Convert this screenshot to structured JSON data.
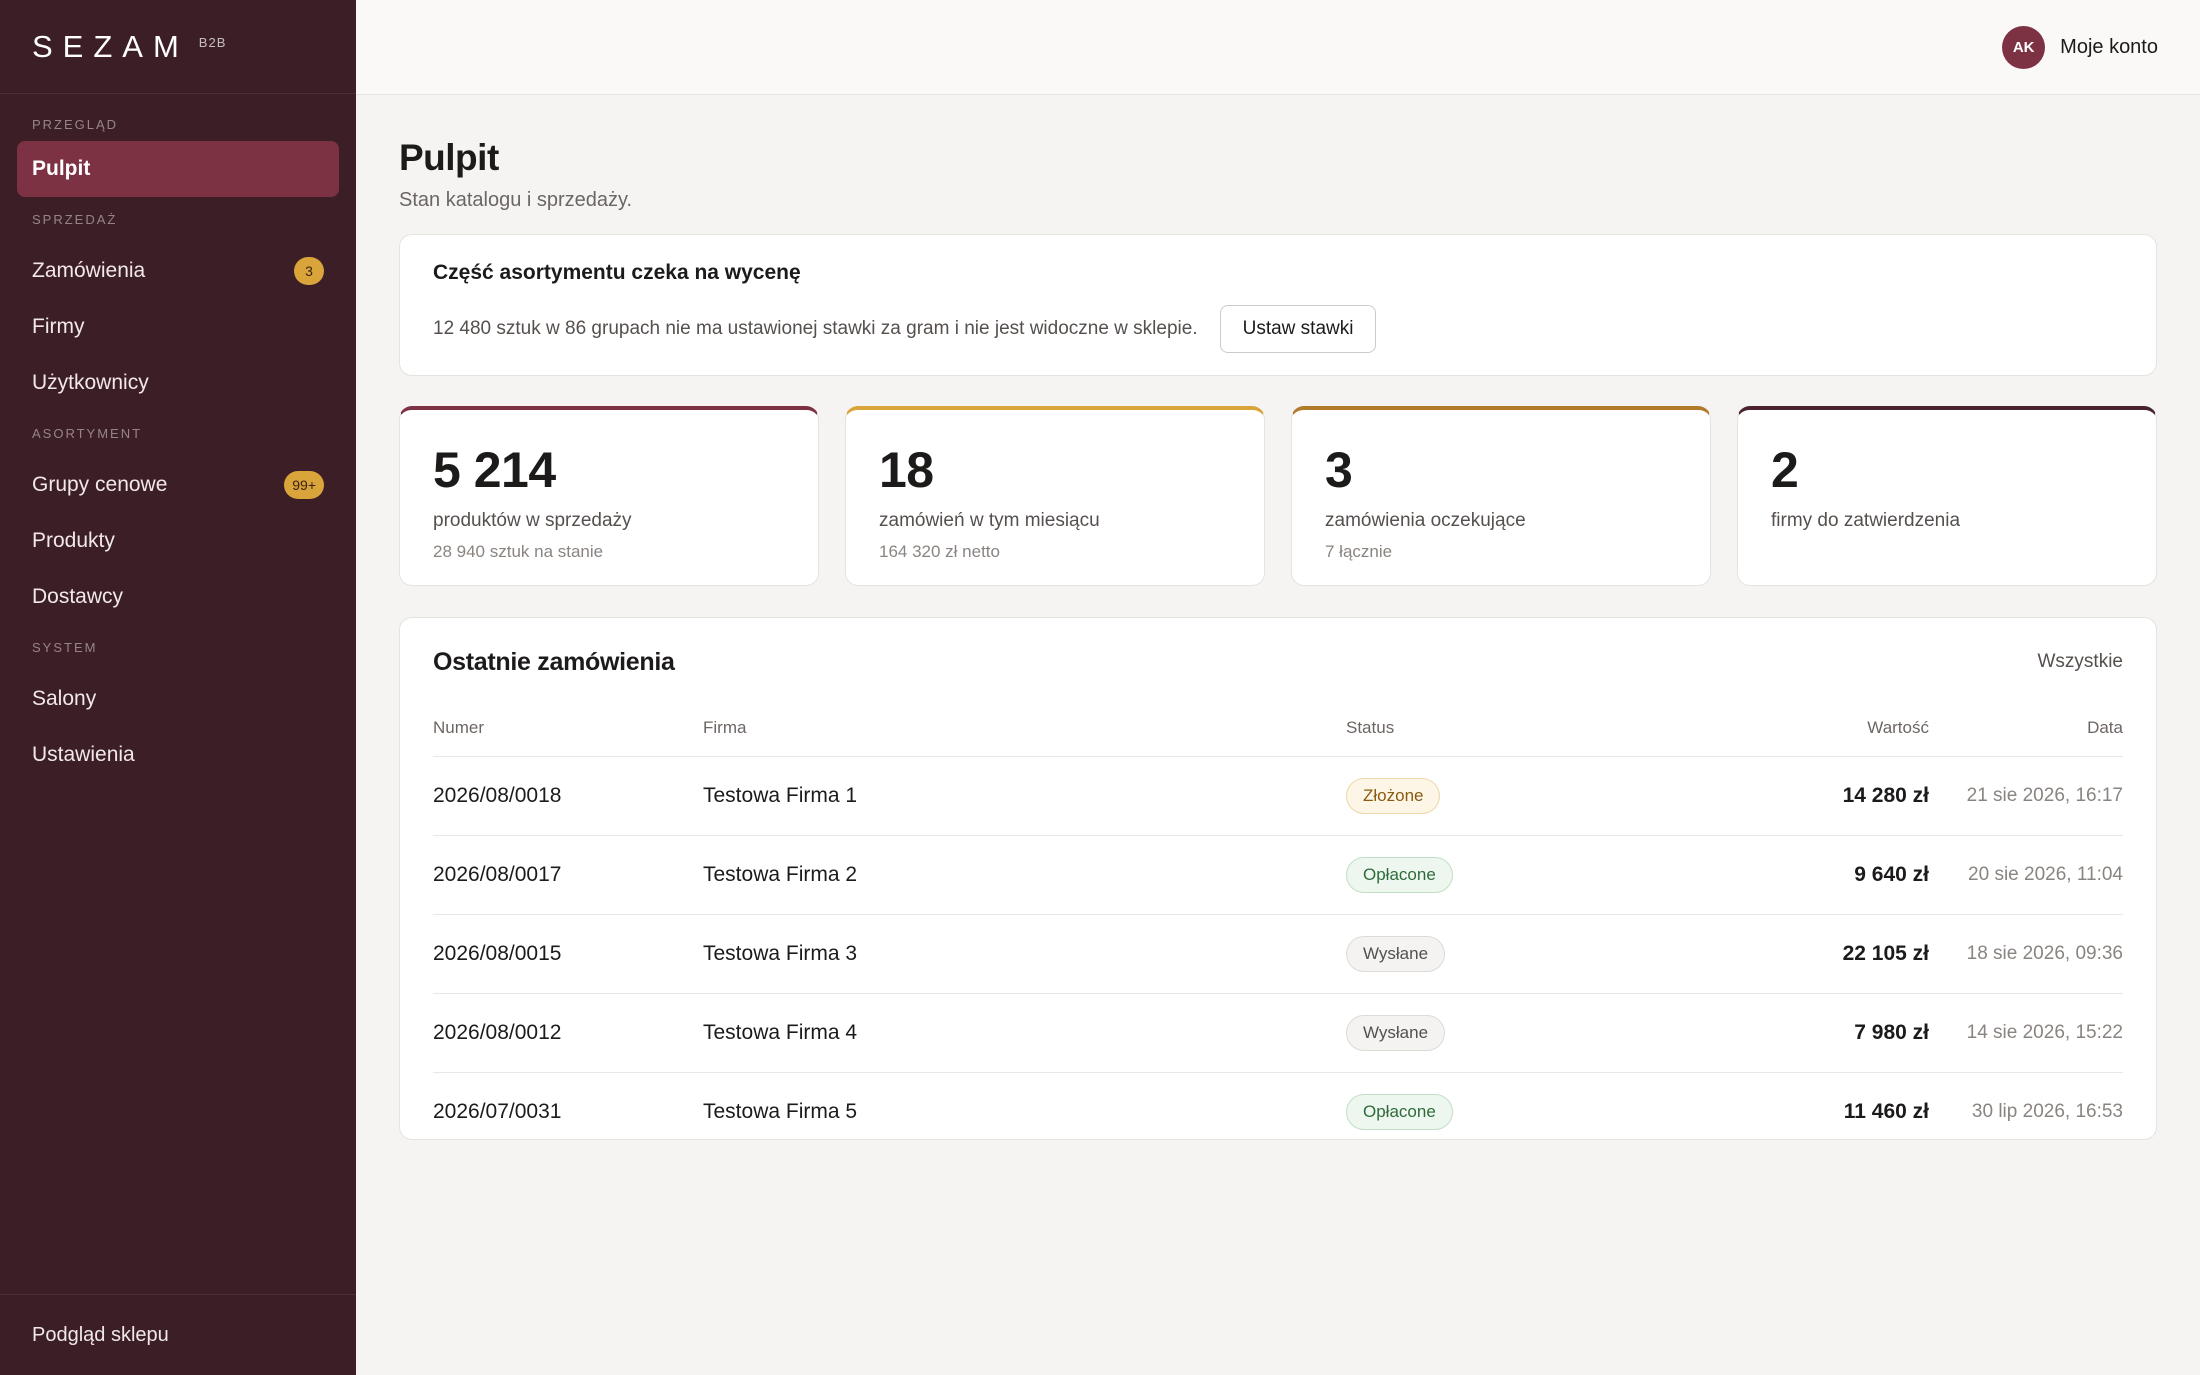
{
  "brand": {
    "name": "SEZAM",
    "tag": "B2B"
  },
  "account": {
    "initials": "AK",
    "label": "Moje konto",
    "avatar_color": "#7d3244"
  },
  "sidebar": {
    "sections": [
      {
        "title": "PRZEGLĄD",
        "items": [
          {
            "label": "Pulpit",
            "active": true,
            "badge": ""
          }
        ]
      },
      {
        "title": "SPRZEDAŻ",
        "items": [
          {
            "label": "Zamówienia",
            "active": false,
            "badge": "3"
          },
          {
            "label": "Firmy",
            "active": false,
            "badge": ""
          },
          {
            "label": "Użytkownicy",
            "active": false,
            "badge": ""
          }
        ]
      },
      {
        "title": "ASORTYMENT",
        "items": [
          {
            "label": "Grupy cenowe",
            "active": false,
            "badge": "99+"
          },
          {
            "label": "Produkty",
            "active": false,
            "badge": ""
          },
          {
            "label": "Dostawcy",
            "active": false,
            "badge": ""
          }
        ]
      },
      {
        "title": "SYSTEM",
        "items": [
          {
            "label": "Salony",
            "active": false,
            "badge": ""
          },
          {
            "label": "Ustawienia",
            "active": false,
            "badge": ""
          }
        ]
      }
    ],
    "footer_label": "Podgląd sklepu"
  },
  "page": {
    "title": "Pulpit",
    "subtitle": "Stan katalogu i sprzedaży."
  },
  "alert": {
    "title": "Część asortymentu czeka na wycenę",
    "text": "12 480 sztuk w 86 grupach nie ma ustawionej stawki za gram i nie jest widoczne w sklepie.",
    "button": "Ustaw stawki"
  },
  "stats": [
    {
      "value": "5 214",
      "label": "produktów w sprzedaży",
      "sub": "28 940 sztuk na stanie",
      "accent": "#7d3244"
    },
    {
      "value": "18",
      "label": "zamówień w tym miesiącu",
      "sub": "164 320 zł netto",
      "accent": "#d9a53a"
    },
    {
      "value": "3",
      "label": "zamówienia oczekujące",
      "sub": "7 łącznie",
      "accent": "#b07a2a"
    },
    {
      "value": "2",
      "label": "firmy do zatwierdzenia",
      "sub": "",
      "accent": "#4a2230"
    }
  ],
  "orders": {
    "title": "Ostatnie zamówienia",
    "all_link": "Wszystkie",
    "columns": {
      "number": "Numer",
      "firm": "Firma",
      "status": "Status",
      "value": "Wartość",
      "date": "Data"
    },
    "rows": [
      {
        "number": "2026/08/0018",
        "firm": "Testowa Firma 1",
        "status": "Złożone",
        "status_kind": "placed",
        "value": "14 280 zł",
        "date": "21 sie 2026, 16:17"
      },
      {
        "number": "2026/08/0017",
        "firm": "Testowa Firma 2",
        "status": "Opłacone",
        "status_kind": "paid",
        "value": "9 640 zł",
        "date": "20 sie 2026, 11:04"
      },
      {
        "number": "2026/08/0015",
        "firm": "Testowa Firma 3",
        "status": "Wysłane",
        "status_kind": "shipped",
        "value": "22 105 zł",
        "date": "18 sie 2026, 09:36"
      },
      {
        "number": "2026/08/0012",
        "firm": "Testowa Firma 4",
        "status": "Wysłane",
        "status_kind": "shipped",
        "value": "7 980 zł",
        "date": "14 sie 2026, 15:22"
      },
      {
        "number": "2026/07/0031",
        "firm": "Testowa Firma 5",
        "status": "Opłacone",
        "status_kind": "paid",
        "value": "11 460 zł",
        "date": "30 lip 2026, 16:53"
      }
    ]
  },
  "status_colors": {
    "placed": {
      "bg": "#fdf6e6",
      "border": "#ecd8a6",
      "text": "#8a5a12"
    },
    "paid": {
      "bg": "#eef7ef",
      "border": "#bfdfc4",
      "text": "#2f6b3a"
    },
    "shipped": {
      "bg": "#f4f3f2",
      "border": "#dedad6",
      "text": "#55504d"
    }
  }
}
